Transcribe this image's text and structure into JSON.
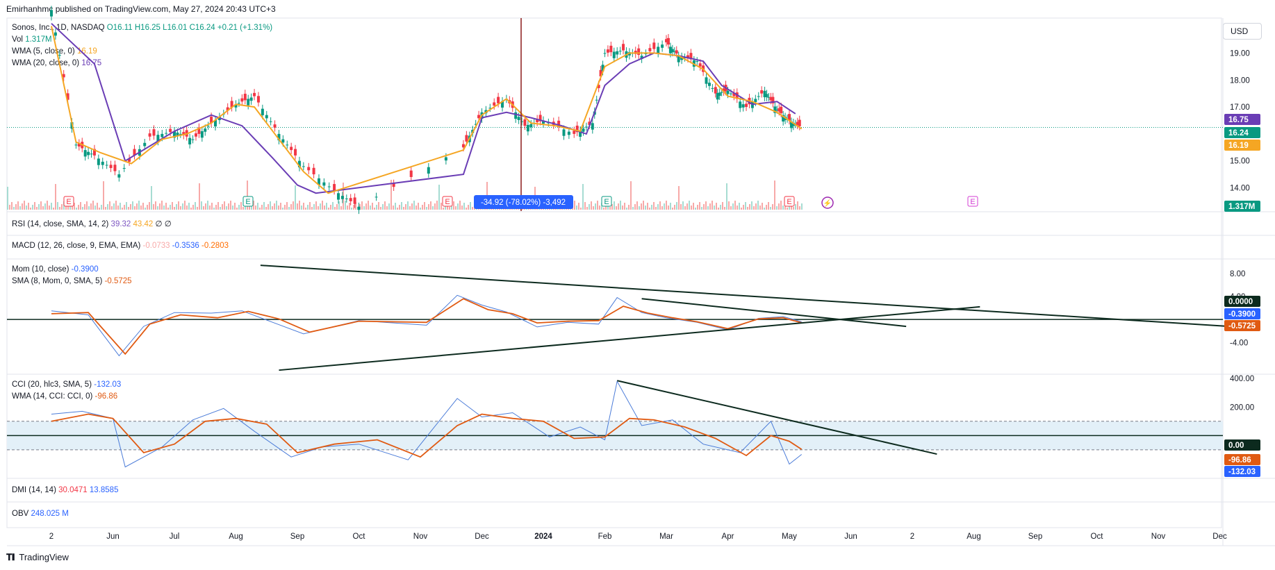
{
  "header": {
    "published": "Emirhanhmc published on TradingView.com, May 27, 2024 20:43 UTC+3"
  },
  "symbol_legend": {
    "title": "Sonos, Inc., 1D, NASDAQ",
    "open": "O16.11",
    "high": "H16.25",
    "low": "L16.01",
    "close": "C16.24",
    "change": "+0.21 (+1.31%)"
  },
  "legends": {
    "vol": {
      "label": "Vol",
      "value": "1.317M"
    },
    "wma5": {
      "label": "WMA (5, close, 0)",
      "value": "16.19"
    },
    "wma20": {
      "label": "WMA (20, close, 0)",
      "value": "16.75"
    },
    "rsi": {
      "label": "RSI (14, close, SMA, 14, 2)",
      "v1": "39.32",
      "v2": "43.42",
      "v3": "∅",
      "v4": "∅"
    },
    "macd": {
      "label": "MACD (12, 26, close, 9, EMA, EMA)",
      "v1": "-0.0733",
      "v2": "-0.3536",
      "v3": "-0.2803"
    },
    "mom": {
      "label": "Mom (10, close)",
      "value": "-0.3900"
    },
    "sma": {
      "label": "SMA (8, Mom, 0, SMA, 5)",
      "value": "-0.5725"
    },
    "cci": {
      "label": "CCI (20, hlc3, SMA, 5)",
      "value": "-132.03"
    },
    "wma_cci": {
      "label": "WMA (14, CCI: CCI, 0)",
      "value": "-96.86"
    },
    "dmi": {
      "label": "DMI (14, 14)",
      "v1": "30.0471",
      "v2": "13.8585"
    },
    "obv": {
      "label": "OBV",
      "value": "248.025 M"
    }
  },
  "measure_label": "-34.92 (-78.02%) -3,492",
  "currency": "USD",
  "footer": {
    "brand": "TradingView"
  },
  "colors": {
    "up": "#089981",
    "down": "#f23645",
    "wma5": "#f5a623",
    "wma20": "#6a3db5",
    "mom": "#4a7bd8",
    "signal": "#e05a12",
    "trend": "#0c2a1e",
    "measure": "#2962ff",
    "event": "#f23645",
    "event_green": "#089981",
    "event_purple": "#d33bd3"
  },
  "chart_data": {
    "type": "line",
    "title": "Sonos, Inc., 1D, NASDAQ",
    "x_axis_labels": [
      "2",
      "Jun",
      "Jul",
      "Aug",
      "Sep",
      "Oct",
      "Nov",
      "Dec",
      "2024",
      "Feb",
      "Mar",
      "Apr",
      "May",
      "Jun",
      "2",
      "Aug",
      "Sep",
      "Oct",
      "Nov",
      "Dec"
    ],
    "price_axis": {
      "ticks": [
        "19.00",
        "18.00",
        "17.00",
        "15.00",
        "14.00"
      ],
      "ylim": [
        13.6,
        20.3
      ]
    },
    "price_badges": [
      {
        "value": "16.75",
        "series": "WMA 20"
      },
      {
        "value": "16.24",
        "series": "Close"
      },
      {
        "value": "16.19",
        "series": "WMA 5"
      }
    ],
    "volume_badge": "1.317M",
    "price_series": {
      "name": "Close",
      "x_months": [
        0,
        0.4,
        0.7,
        1.1,
        1.6,
        2.0,
        2.3,
        2.6,
        3.0,
        3.3,
        3.7,
        4.1,
        4.6,
        5.0,
        6.7,
        7.0,
        7.4,
        7.7,
        8.0,
        8.5,
        8.8,
        9.0,
        9.3,
        9.6,
        10.0,
        10.2,
        10.5,
        10.8,
        11.0,
        11.3,
        11.6,
        11.8,
        12.0,
        12.2
      ],
      "values": [
        20.6,
        15.6,
        15.2,
        14.5,
        15.9,
        16.1,
        15.8,
        16.4,
        17.1,
        17.4,
        16.0,
        14.8,
        13.9,
        13.3,
        15.5,
        16.8,
        17.3,
        16.3,
        16.5,
        16.0,
        16.4,
        19.0,
        19.1,
        18.9,
        19.4,
        18.9,
        18.7,
        17.5,
        17.6,
        17.0,
        17.6,
        16.9,
        16.5,
        16.24
      ]
    },
    "wma20_series": {
      "name": "WMA (20, close, 0)",
      "x_months": [
        0,
        0.7,
        1.2,
        2.0,
        2.6,
        3.1,
        3.6,
        4.0,
        4.3,
        6.7,
        7.0,
        7.4,
        7.8,
        8.3,
        8.7,
        9.0,
        9.4,
        9.8,
        10.2,
        10.6,
        10.9,
        11.4,
        11.8,
        12.1
      ],
      "values": [
        20.1,
        18.6,
        15.0,
        16.1,
        16.7,
        16.3,
        15.1,
        14.1,
        13.8,
        14.5,
        16.6,
        16.8,
        16.6,
        16.3,
        16.0,
        17.8,
        18.6,
        19.0,
        18.9,
        18.7,
        17.8,
        17.1,
        17.2,
        16.75
      ]
    },
    "wma5_series": {
      "name": "WMA (5, close, 0)",
      "x_months": [
        0,
        0.4,
        0.8,
        1.3,
        1.8,
        2.2,
        2.6,
        3.0,
        3.3,
        3.7,
        4.1,
        4.5,
        6.7,
        7.0,
        7.4,
        7.8,
        8.2,
        8.6,
        9.0,
        9.4,
        9.8,
        10.2,
        10.6,
        11.0,
        11.4,
        11.8,
        12.2
      ],
      "values": [
        20.0,
        15.7,
        15.3,
        14.9,
        15.8,
        16.0,
        16.4,
        17.1,
        17.0,
        15.8,
        14.6,
        13.8,
        15.4,
        16.7,
        17.3,
        16.4,
        16.3,
        16.1,
        18.5,
        19.0,
        19.0,
        18.9,
        18.4,
        17.4,
        17.2,
        16.8,
        16.19
      ]
    },
    "momentum": {
      "axis_ticks": [
        "8.00",
        "4.00",
        "-4.00"
      ],
      "ylim": [
        -9.5,
        10.5
      ],
      "badges": [
        {
          "value": "0.0000",
          "series": "zero line"
        },
        {
          "value": "-0.3900",
          "series": "Mom (10, close)"
        },
        {
          "value": "-0.5725",
          "series": "SMA (8, Mom, 0, SMA, 5)"
        }
      ],
      "mom_x_months": [
        0,
        0.6,
        1.1,
        1.5,
        2.0,
        2.6,
        3.1,
        3.6,
        4.1,
        5.0,
        6.1,
        6.6,
        7.0,
        7.4,
        7.9,
        8.4,
        8.9,
        9.2,
        9.6,
        10.0,
        10.5,
        11.0,
        11.5,
        11.9,
        12.2
      ],
      "mom_values": [
        1.5,
        0.8,
        -6.3,
        -1.2,
        1.2,
        1.1,
        1.5,
        -0.5,
        -2.5,
        -0.2,
        -1.0,
        4.2,
        2.5,
        1.3,
        -1.3,
        -0.5,
        -0.8,
        3.8,
        1.2,
        0.3,
        -0.5,
        -1.8,
        0.2,
        0.5,
        -0.39
      ],
      "sma_x_months": [
        0,
        0.6,
        1.2,
        1.6,
        2.1,
        2.7,
        3.2,
        3.7,
        4.2,
        5.0,
        6.1,
        6.7,
        7.1,
        7.5,
        7.9,
        8.4,
        8.9,
        9.3,
        9.7,
        10.1,
        10.5,
        11.0,
        11.5,
        11.9,
        12.2
      ],
      "sma_values": [
        1.0,
        1.2,
        -6.0,
        -0.8,
        0.8,
        0.3,
        1.4,
        0.1,
        -2.2,
        -0.3,
        -0.5,
        3.6,
        1.7,
        1.0,
        -0.6,
        -0.3,
        -0.2,
        2.3,
        1.1,
        0.3,
        -0.4,
        -1.6,
        0.1,
        0.3,
        -0.5725
      ],
      "trendlines": [
        {
          "x_months": [
            3.4,
            19.6
          ],
          "values": [
            9.4,
            -1.5
          ]
        },
        {
          "x_months": [
            3.7,
            15.1
          ],
          "values": [
            -8.8,
            2.2
          ]
        },
        {
          "x_months": [
            9.6,
            13.9
          ],
          "values": [
            3.6,
            -1.2
          ]
        }
      ]
    },
    "cci": {
      "axis_ticks": [
        "400.00",
        "200.00"
      ],
      "ylim": [
        -300,
        430
      ],
      "band": [
        -100,
        100
      ],
      "badges": [
        {
          "value": "0.00",
          "series": "zero line"
        },
        {
          "value": "-96.86",
          "series": "WMA (14, CCI: CCI, 0)"
        },
        {
          "value": "-132.03",
          "series": "CCI (20, hlc3, SMA, 5)"
        }
      ],
      "cci_x_months": [
        0,
        0.5,
        1.0,
        1.2,
        1.8,
        2.3,
        2.8,
        3.3,
        3.9,
        4.4,
        5.0,
        5.8,
        6.6,
        7.0,
        7.5,
        8.1,
        8.6,
        9.0,
        9.2,
        9.6,
        10.1,
        10.6,
        11.2,
        11.7,
        12.0,
        12.2
      ],
      "cci_values": [
        150,
        170,
        120,
        -220,
        -80,
        110,
        190,
        30,
        -150,
        -80,
        -60,
        -170,
        260,
        130,
        160,
        -10,
        60,
        -30,
        380,
        70,
        110,
        -60,
        -120,
        100,
        -200,
        -132.03
      ],
      "wma_x_months": [
        0,
        0.6,
        1.0,
        1.5,
        2.0,
        2.5,
        3.0,
        3.5,
        4.0,
        4.6,
        5.3,
        6.0,
        6.6,
        7.0,
        7.5,
        8.0,
        8.5,
        9.0,
        9.4,
        9.8,
        10.3,
        10.8,
        11.3,
        11.7,
        12.0,
        12.2
      ],
      "wma_values": [
        100,
        150,
        120,
        -120,
        -60,
        100,
        120,
        80,
        -120,
        -60,
        -30,
        -150,
        70,
        150,
        120,
        100,
        -20,
        -10,
        120,
        110,
        60,
        -20,
        -140,
        0,
        -40,
        -96.86
      ],
      "trendlines": [
        {
          "x_months": [
            9.2,
            14.4
          ],
          "values": [
            385,
            -130
          ]
        }
      ]
    },
    "volume_ratio_visible": "volume histogram at bottom of price pane"
  }
}
